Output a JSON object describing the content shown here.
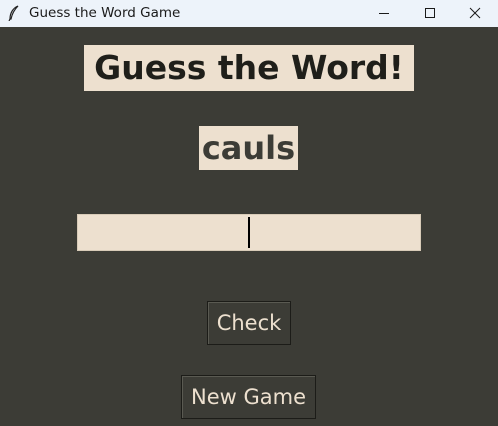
{
  "window": {
    "title": "Guess the Word Game",
    "icon": "feather-icon",
    "controls": [
      "minimize-icon",
      "maximize-icon",
      "close-icon"
    ]
  },
  "main": {
    "heading": "Guess the Word!",
    "scrambled_word": "cauls",
    "guess_input_value": "",
    "check_button_label": "Check",
    "new_game_button_label": "New Game"
  },
  "colors": {
    "background": "#3c3c36",
    "label_background": "#ede0cf",
    "titlebar": "#edf3fa",
    "heading_text": "#1f1f1a",
    "button_text": "#ede0cf"
  }
}
